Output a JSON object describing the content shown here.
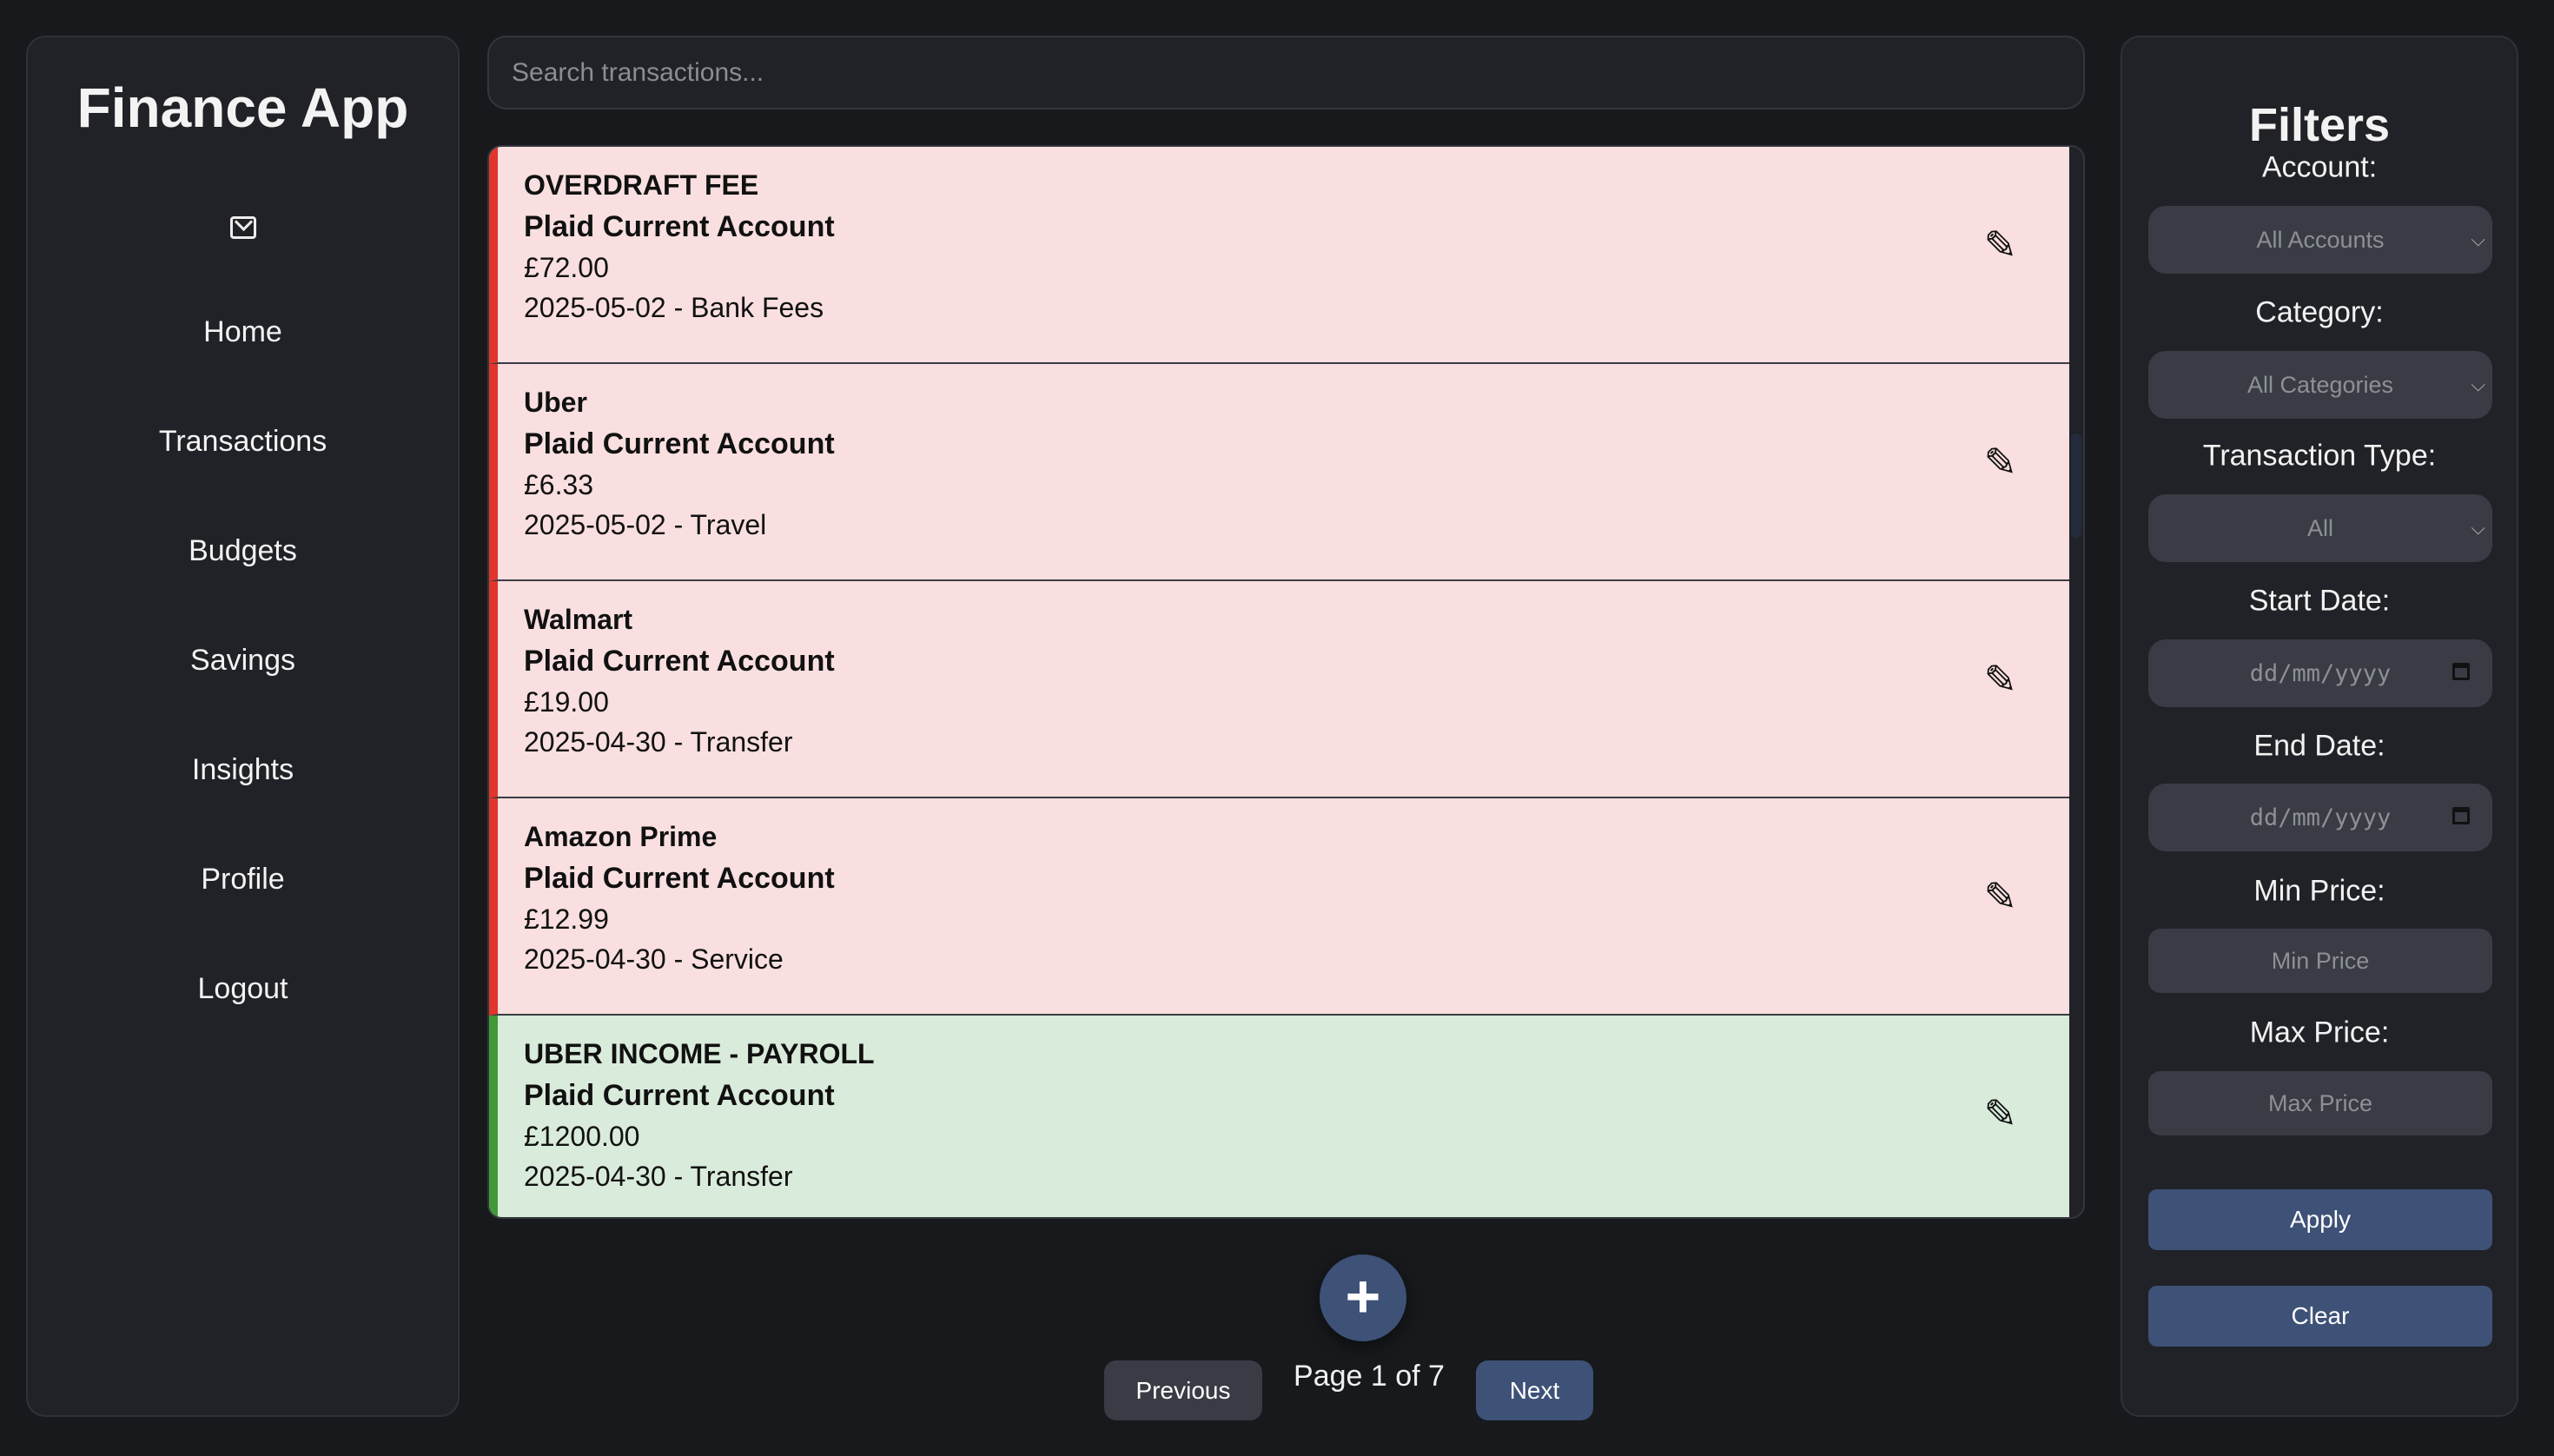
{
  "sidebar": {
    "title": "Finance App",
    "items": [
      "Home",
      "Transactions",
      "Budgets",
      "Savings",
      "Insights",
      "Profile",
      "Logout"
    ]
  },
  "search": {
    "placeholder": "Search transactions..."
  },
  "transactions": [
    {
      "name": "OVERDRAFT FEE",
      "account": "Plaid Current Account",
      "amount": "£72.00",
      "meta": "2025-05-02 - Bank Fees",
      "type": "expense"
    },
    {
      "name": "Uber",
      "account": "Plaid Current Account",
      "amount": "£6.33",
      "meta": "2025-05-02 - Travel",
      "type": "expense"
    },
    {
      "name": "Walmart",
      "account": "Plaid Current Account",
      "amount": "£19.00",
      "meta": "2025-04-30 - Transfer",
      "type": "expense"
    },
    {
      "name": "Amazon Prime",
      "account": "Plaid Current Account",
      "amount": "£12.99",
      "meta": "2025-04-30 - Service",
      "type": "expense"
    },
    {
      "name": "UBER INCOME - PAYROLL",
      "account": "Plaid Current Account",
      "amount": "£1200.00",
      "meta": "2025-04-30 - Transfer",
      "type": "income"
    }
  ],
  "edit_icon": "✎",
  "add_icon": "+",
  "pagination": {
    "previous": "Previous",
    "page_text": "Page 1 of 7",
    "next": "Next"
  },
  "filters": {
    "title": "Filters",
    "account_label": "Account:",
    "account_value": "All Accounts",
    "category_label": "Category:",
    "category_value": "All Categories",
    "type_label": "Transaction Type:",
    "type_value": "All",
    "start_label": "Start Date:",
    "start_placeholder": "dd/mm/yyyy",
    "end_label": "End Date:",
    "end_placeholder": "dd/mm/yyyy",
    "min_label": "Min Price:",
    "min_placeholder": "Min Price",
    "max_label": "Max Price:",
    "max_placeholder": "Max Price",
    "apply": "Apply",
    "clear": "Clear"
  },
  "colors": {
    "expense": "#f9dfe0",
    "expense_border": "#e0352b",
    "income": "#d9ebdb",
    "income_border": "#3f9a37",
    "accent": "#3e5177"
  }
}
